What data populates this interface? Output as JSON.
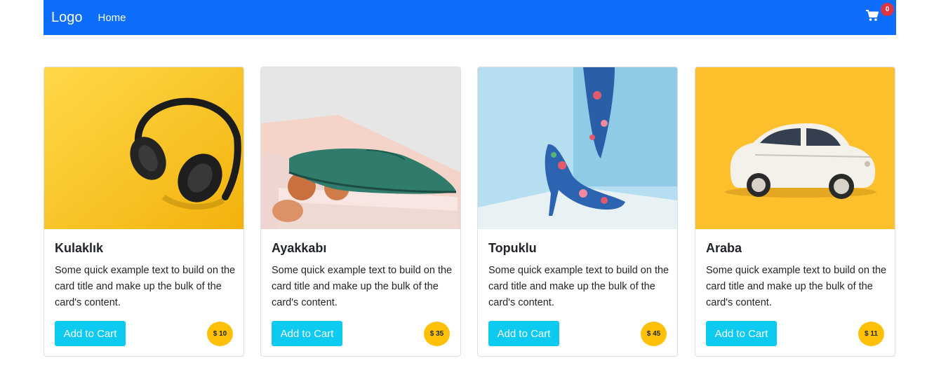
{
  "navbar": {
    "logo": "Logo",
    "home": "Home",
    "cart_count": "0",
    "bg_color": "#0d6efd"
  },
  "products": [
    {
      "title": "Kulaklık",
      "text": "Some quick example text to build on the card title and make up the bulk of the card's content.",
      "button": "Add to Cart",
      "price": "$ 10",
      "image": "headphones-on-yellow"
    },
    {
      "title": "Ayakkabı",
      "text": "Some quick example text to build on the card title and make up the bulk of the card's content.",
      "button": "Add to Cart",
      "price": "$ 35",
      "image": "green-shoe"
    },
    {
      "title": "Topuklu",
      "text": "Some quick example text to build on the card title and make up the bulk of the card's content.",
      "button": "Add to Cart",
      "price": "$ 45",
      "image": "floral-high-heels"
    },
    {
      "title": "Araba",
      "text": "Some quick example text to build on the card title and make up the bulk of the card's content.",
      "button": "Add to Cart",
      "price": "$ 11",
      "image": "white-toy-car"
    }
  ],
  "colors": {
    "button": "#0dcaf0",
    "price_badge": "#ffc107",
    "cart_badge": "#dc3545"
  }
}
